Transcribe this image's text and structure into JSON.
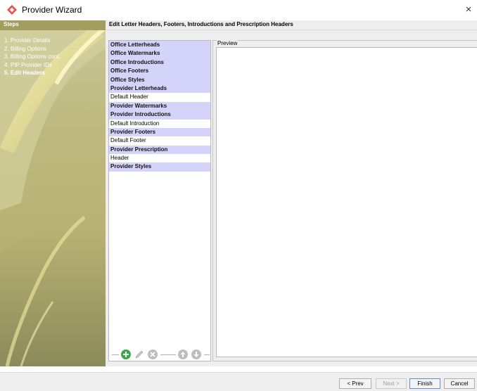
{
  "window": {
    "title": "Provider Wizard",
    "close_glyph": "×"
  },
  "sidebar": {
    "header": "Steps",
    "steps": [
      "1. Provider Details",
      "2. Billing Options",
      "3. Billing Options cont.",
      "4. PIP Provider IDs",
      "5. Edit Headers"
    ],
    "active_step": 4
  },
  "content": {
    "title": "Edit Letter Headers, Footers, Introductions and Prescription Headers"
  },
  "tree": [
    {
      "label": "Office Letterheads",
      "kind": "group"
    },
    {
      "label": "Office Watermarks",
      "kind": "group"
    },
    {
      "label": "Office Introductions",
      "kind": "group"
    },
    {
      "label": "Office Footers",
      "kind": "group"
    },
    {
      "label": "Office Styles",
      "kind": "group"
    },
    {
      "label": "Provider Letterheads",
      "kind": "group"
    },
    {
      "label": "Default Header",
      "kind": "item"
    },
    {
      "label": "Provider Watermarks",
      "kind": "group"
    },
    {
      "label": "Provider Introductions",
      "kind": "group"
    },
    {
      "label": "Default Introduction",
      "kind": "item"
    },
    {
      "label": "Provider Footers",
      "kind": "group"
    },
    {
      "label": "Default Footer",
      "kind": "item"
    },
    {
      "label": "Provider Prescription",
      "kind": "group"
    },
    {
      "label": "Header",
      "kind": "item"
    },
    {
      "label": "Provider Styles",
      "kind": "group"
    }
  ],
  "toolbar": {
    "icons": [
      "add-icon",
      "edit-icon",
      "delete-icon",
      "move-up-icon",
      "move-down-icon"
    ]
  },
  "preview": {
    "label": "Preview"
  },
  "buttons": {
    "prev": "< Prev",
    "next": "Next >",
    "finish": "Finish",
    "cancel": "Cancel"
  },
  "colors": {
    "group_row": "#d4d4fa",
    "steps_header": "#a39e5e",
    "add_green": "#3aa84a"
  }
}
